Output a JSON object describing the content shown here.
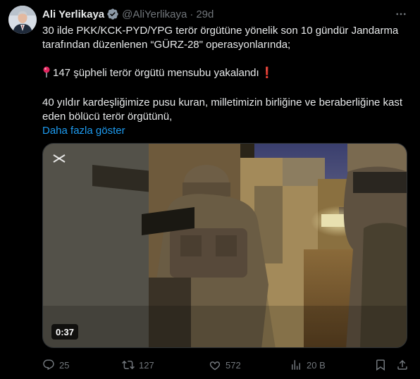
{
  "author": {
    "name": "Ali Yerlikaya",
    "handle": "@AliYerlikaya",
    "separator": "·",
    "time": "29d"
  },
  "tweet": {
    "line1": "30 ilde PKK/KCK-PYD/YPG terör örgütüne yönelik son 10 gündür Jandarma tarafından düzenlenen “GÜRZ-28\" operasyonlarında;",
    "line2": "147 şüpheli terör örgütü mensubu yakalandı",
    "line2_suffix": "❗",
    "line3": "40 yıldır kardeşliğimize pusu kuran, milletimizin birliğine ve beraberliğine kast eden bölücü terör örgütünü,",
    "show_more": "Daha fazla göster"
  },
  "media": {
    "duration": "0:37"
  },
  "actions": {
    "replies": "25",
    "retweets": "127",
    "likes": "572",
    "views": "20 B"
  },
  "colors": {
    "background": "#000000",
    "text": "#e7e9ea",
    "muted": "#71767b",
    "link": "#1d9bf0",
    "verified": "#8b98a5"
  }
}
